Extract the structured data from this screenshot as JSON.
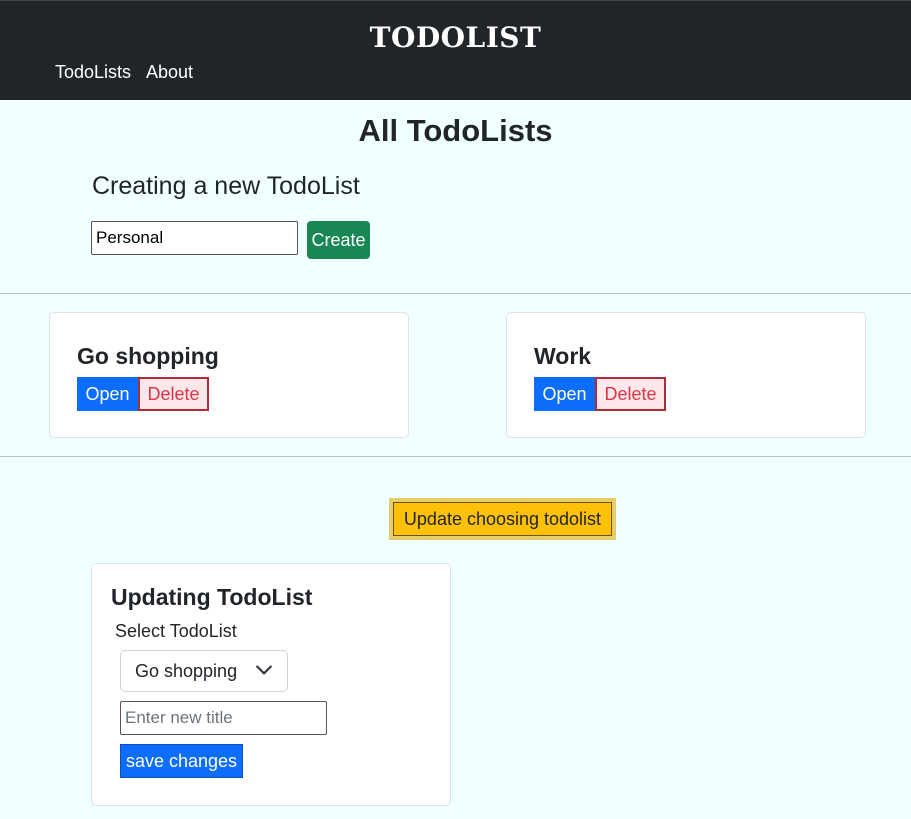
{
  "nav": {
    "brand": "TODOLIST",
    "links": [
      "TodoLists",
      "About"
    ]
  },
  "page_title": "All TodoLists",
  "create": {
    "heading": "Creating a new TodoList",
    "input_value": "Personal",
    "button": "Create"
  },
  "todolists": [
    {
      "title": "Go shopping",
      "open": "Open",
      "delete": "Delete"
    },
    {
      "title": "Work",
      "open": "Open",
      "delete": "Delete"
    }
  ],
  "update_toggle": "Update choosing todolist",
  "update": {
    "title": "Updating TodoList",
    "select_label": "Select TodoList",
    "selected": "Go shopping",
    "title_placeholder": "Enter new title",
    "save": "save changes"
  },
  "colors": {
    "nav_bg": "#212529",
    "page_bg": "#f0ffff",
    "primary": "#0d6efd",
    "success": "#198754",
    "danger": "#dc3545",
    "warning": "#ffc107"
  }
}
